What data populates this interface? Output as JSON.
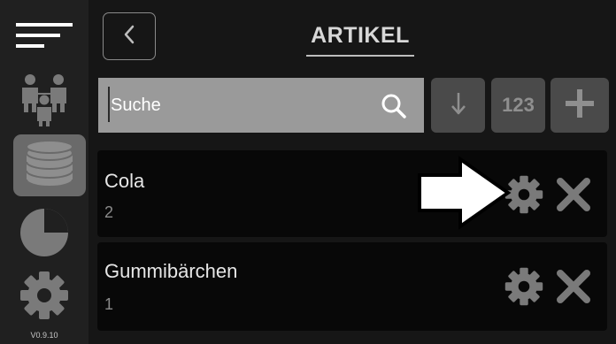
{
  "header": {
    "title": "ARTIKEL"
  },
  "search": {
    "placeholder": "Suche",
    "value": ""
  },
  "toolbar": {
    "number_label": "123"
  },
  "sidebar": {
    "version": "V0.9.10"
  },
  "items": [
    {
      "name": "Cola",
      "count": "2"
    },
    {
      "name": "Gummibärchen",
      "count": "1"
    }
  ],
  "colors": {
    "background": "#161616",
    "sidebar": "#202020",
    "active_nav": "#6a6a6a",
    "search_box": "#9a9a9a",
    "tool_button": "#4a4a4a",
    "list_item": "#080808",
    "icon_gray": "#7a7a7a"
  },
  "icons": [
    "menu-icon",
    "persons-icon",
    "database-icon",
    "pie-chart-icon",
    "gear-icon",
    "back-chevron-icon",
    "search-icon",
    "sort-down-icon",
    "plus-icon",
    "close-icon",
    "arrow-pointer-icon"
  ]
}
